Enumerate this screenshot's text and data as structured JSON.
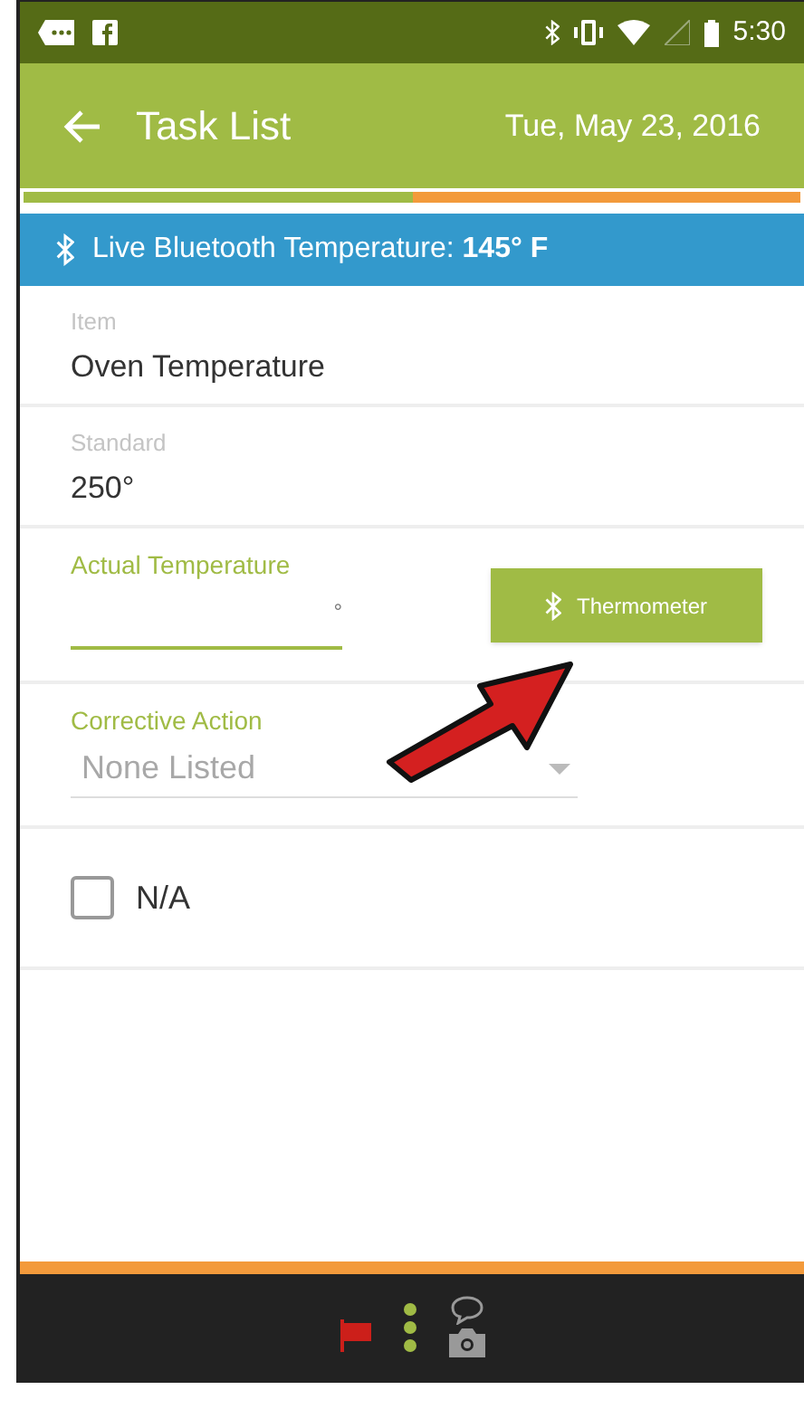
{
  "status_bar": {
    "time": "5:30"
  },
  "app_bar": {
    "title": "Task List",
    "date": "Tue, May 23, 2016"
  },
  "progress": {
    "level": 0.5
  },
  "banner": {
    "text": "Live Bluetooth Temperature: **145° F**"
  },
  "fields": [
    {
      "kind": "readonly",
      "label": "Item",
      "value": "Oven Temperature"
    },
    {
      "kind": "readonly",
      "label": "Standard",
      "value": "250°"
    },
    {
      "kind": "input",
      "label": "Actual Temperature",
      "unit": "°",
      "button": "Thermometer"
    },
    {
      "kind": "select",
      "label": "Corrective Action",
      "placeholder": "None Listed"
    },
    {
      "kind": "checkbox",
      "label": "N/A",
      "checked": false
    }
  ]
}
